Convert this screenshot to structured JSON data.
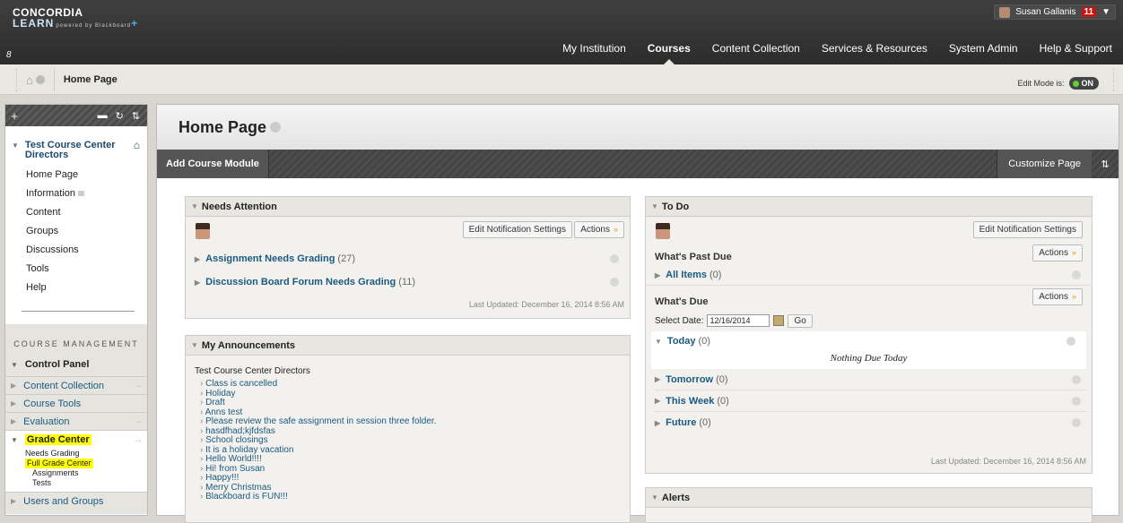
{
  "brand": {
    "line1": "CONCORDIA",
    "line2": "LEARN",
    "sub": "powered by Blackboard",
    "plus": "+"
  },
  "user": {
    "name": "Susan Gallanis",
    "badge": "11"
  },
  "nav": [
    "My Institution",
    "Courses",
    "Content Collection",
    "Services & Resources",
    "System Admin",
    "Help & Support"
  ],
  "breadcrumb": {
    "title": "Home Page",
    "edit_mode_label": "Edit Mode is:",
    "edit_mode_value": "ON"
  },
  "sidebar": {
    "course_title": "Test Course Center Directors",
    "items": [
      "Home Page",
      "Information",
      "Content",
      "Groups",
      "Discussions",
      "Tools",
      "Help"
    ],
    "cm_header": "COURSE MANAGEMENT",
    "control_panel": "Control Panel",
    "cm_items": [
      "Content Collection",
      "Course Tools",
      "Evaluation"
    ],
    "grade_center": "Grade Center",
    "grade_sub": [
      "Needs Grading",
      "Full Grade Center",
      "Assignments",
      "Tests"
    ],
    "users_groups": "Users and Groups"
  },
  "main": {
    "title": "Home Page",
    "add_module": "Add Course Module",
    "customize": "Customize Page"
  },
  "needs_attention": {
    "title": "Needs Attention",
    "btn_settings": "Edit Notification Settings",
    "btn_actions": "Actions",
    "items": [
      {
        "label": "Assignment Needs Grading",
        "count": "(27)"
      },
      {
        "label": "Discussion Board Forum Needs Grading",
        "count": "(11)"
      }
    ],
    "updated": "Last Updated: December 16, 2014 8:56 AM"
  },
  "announcements": {
    "title": "My Announcements",
    "course": "Test Course Center Directors",
    "items": [
      "Class is cancelled",
      "Holiday",
      "Draft",
      "Anns test",
      "Please review the safe assignment in session three folder.",
      "hasdfhad;kjfdsfas",
      "School closings",
      "It is a holiday vacation",
      "Hello World!!!!",
      "Hi! from Susan",
      "Happy!!!",
      "Merry Christmas",
      "Blackboard is FUN!!!"
    ]
  },
  "todo": {
    "title": "To Do",
    "btn_settings": "Edit Notification Settings",
    "past_due": "What's Past Due",
    "btn_actions": "Actions",
    "all_items": "All Items",
    "all_count": "(0)",
    "whats_due": "What's Due",
    "select_date_label": "Select Date:",
    "date_value": "12/16/2014",
    "go": "Go",
    "today": "Today",
    "today_count": "(0)",
    "nothing": "Nothing Due Today",
    "tomorrow": "Tomorrow",
    "tomorrow_count": "(0)",
    "this_week": "This Week",
    "this_week_count": "(0)",
    "future": "Future",
    "future_count": "(0)",
    "updated": "Last Updated: December 16, 2014 8:56 AM"
  },
  "alerts": {
    "title": "Alerts"
  },
  "colors": {
    "highlight": "#ffff00",
    "link": "#1a5a80",
    "toggle_on": "#66cc33",
    "badge": "#cc1111"
  }
}
